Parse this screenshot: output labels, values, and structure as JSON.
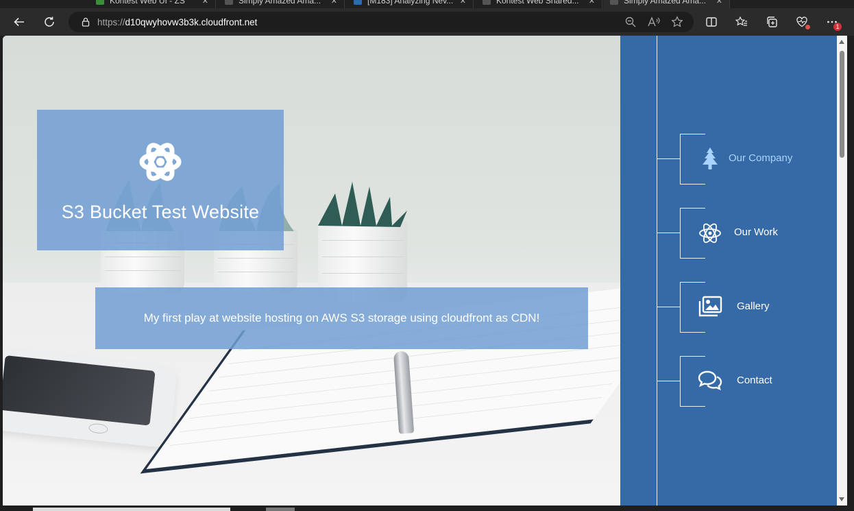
{
  "browser": {
    "tabs": [
      {
        "title": "Kontest Web UI - ZS"
      },
      {
        "title": "Simply Amazed Ama..."
      },
      {
        "title": "[M183] Analyzing Nev..."
      },
      {
        "title": "Kontest Web Shared..."
      },
      {
        "title": "Simply Amazed Ama..."
      }
    ],
    "url_scheme": "https://",
    "url_host": "d10qwyhovw3b3k.cloudfront.net",
    "notification_count": "1"
  },
  "page": {
    "site_title": "S3 Bucket Test Website",
    "tagline": "My first play at website hosting on AWS S3 storage using cloudfront as CDN!",
    "nav": [
      {
        "label": "Our Company",
        "icon": "tree-icon",
        "active": true
      },
      {
        "label": "Our Work",
        "icon": "atom-icon",
        "active": false
      },
      {
        "label": "Gallery",
        "icon": "gallery-icon",
        "active": false
      },
      {
        "label": "Contact",
        "icon": "chat-icon",
        "active": false
      }
    ]
  },
  "colors": {
    "nav_background": "#366aa6",
    "overlay_box": "#719dd4",
    "active_nav_text": "#a9d3ff"
  }
}
